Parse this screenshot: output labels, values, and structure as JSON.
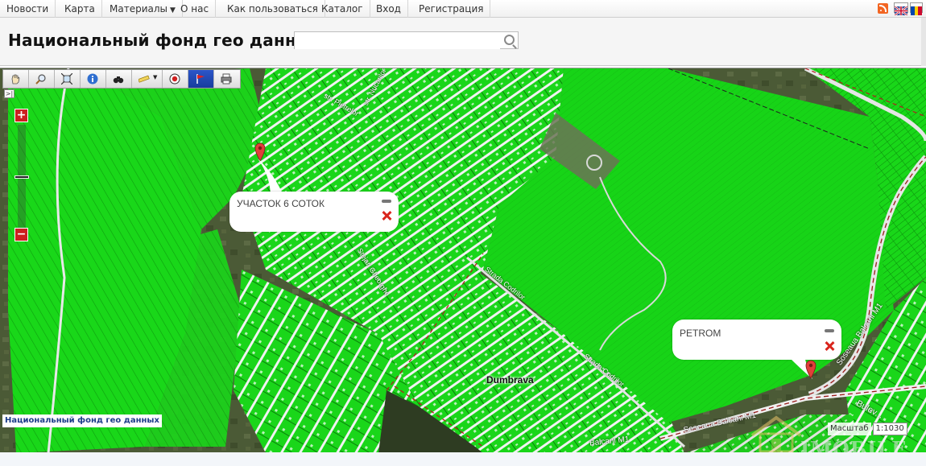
{
  "nav": {
    "items": [
      {
        "label": "Новости"
      },
      {
        "label": "Карта"
      },
      {
        "label": "Материалы",
        "has_dropdown": true
      },
      {
        "label": "О нас"
      },
      {
        "label": "Как пользоваться"
      },
      {
        "label": "Каталог"
      },
      {
        "label": "Вход"
      },
      {
        "label": "Регистрация"
      }
    ],
    "icons": [
      "rss-icon",
      "uk-flag-icon",
      "language-flag-icon"
    ]
  },
  "header": {
    "title": "Национальный фонд гео данных",
    "search": {
      "value": "",
      "placeholder": ""
    }
  },
  "toolbar": {
    "tools": [
      "pan-hand-icon",
      "zoom-icon",
      "extent-icon",
      "info-icon",
      "binoculars-icon",
      "measure-icon",
      "target-icon",
      "flag-icon",
      "print-icon"
    ],
    "active_tool": "flag-icon"
  },
  "zoom": {
    "plus": "+",
    "minus": "−"
  },
  "popups": [
    {
      "text": "УЧАСТОК 6 СОТОК"
    },
    {
      "text": "PETROM"
    }
  ],
  "map_labels": {
    "town": "Dumbrava",
    "streets": [
      "str. Nucarilor",
      "str. Pietrelor",
      "Stejari Gheorghe",
      "Strada Codrilor",
      "Strada Codrilor",
      "Soseaua Balcani M1",
      "Soseaua Balcani M1",
      "Balcani M1",
      "Bulev..."
    ],
    "attribution": "Национальный фонд гео данных",
    "scale_label": "Масштаб",
    "scale_value": "1:1030"
  },
  "watermark": {
    "text": "IMOBILE"
  },
  "colors": {
    "parcel_green": "#19d719",
    "parcel_outline": "#0a8f0a",
    "active_tool": "#1d43b0",
    "zoom_buttons": "#cc2020",
    "close_x": "#d9251d"
  }
}
